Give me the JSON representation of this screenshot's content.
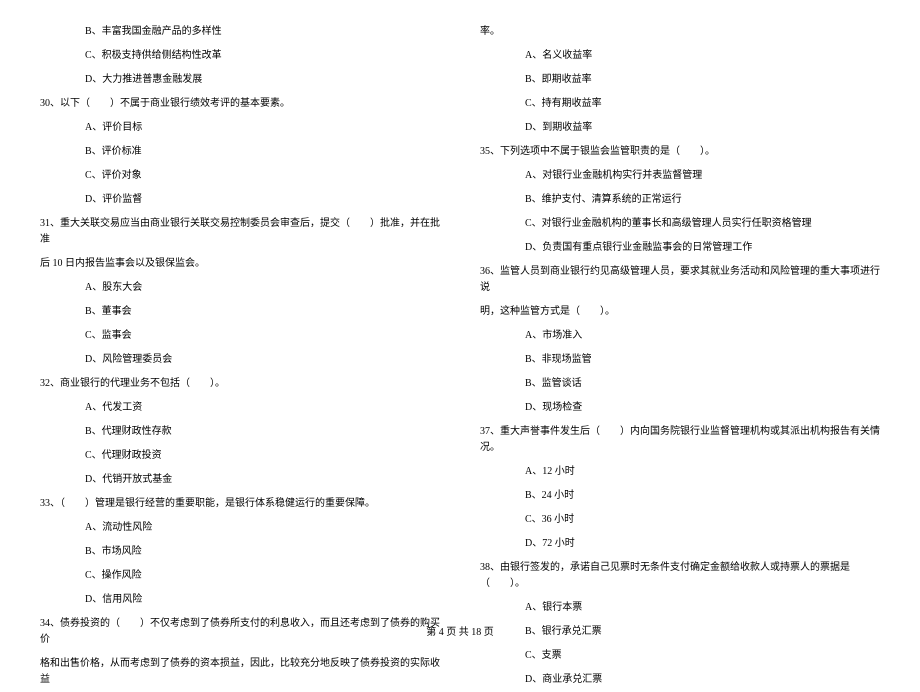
{
  "left_column": {
    "q29_options": [
      "B、丰富我国金融产品的多样性",
      "C、积极支持供给侧结构性改革",
      "D、大力推进普惠金融发展"
    ],
    "q30": {
      "text": "30、以下（　　）不属于商业银行绩效考评的基本要素。",
      "options": [
        "A、评价目标",
        "B、评价标准",
        "C、评价对象",
        "D、评价监督"
      ]
    },
    "q31": {
      "text": "31、重大关联交易应当由商业银行关联交易控制委员会审查后，提交（　　）批准，并在批准",
      "text_cont": "后 10 日内报告监事会以及银保监会。",
      "options": [
        "A、股东大会",
        "B、董事会",
        "C、监事会",
        "D、风险管理委员会"
      ]
    },
    "q32": {
      "text": "32、商业银行的代理业务不包括（　　）。",
      "options": [
        "A、代发工资",
        "B、代理财政性存款",
        "C、代理财政投资",
        "D、代销开放式基金"
      ]
    },
    "q33": {
      "text": "33、（　　）管理是银行经营的重要职能，是银行体系稳健运行的重要保障。",
      "options": [
        "A、流动性风险",
        "B、市场风险",
        "C、操作风险",
        "D、信用风险"
      ]
    },
    "q34": {
      "text": "34、债券投资的（　　）不仅考虑到了债券所支付的利息收入，而且还考虑到了债券的购买价",
      "text_cont": "格和出售价格，从而考虑到了债券的资本损益，因此，比较充分地反映了债券投资的实际收益"
    }
  },
  "right_column": {
    "q34_cont": "率。",
    "q34_options": [
      "A、名义收益率",
      "B、即期收益率",
      "C、持有期收益率",
      "D、到期收益率"
    ],
    "q35": {
      "text": "35、下列选项中不属于银监会监管职责的是（　　）。",
      "options": [
        "A、对银行业金融机构实行并表监督管理",
        "B、维护支付、清算系统的正常运行",
        "C、对银行业金融机构的董事长和高级管理人员实行任职资格管理",
        "D、负责国有重点银行业金融监事会的日常管理工作"
      ]
    },
    "q36": {
      "text": "36、监管人员到商业银行约见高级管理人员，要求其就业务活动和风险管理的重大事项进行说",
      "text_cont": "明，这种监管方式是（　　）。",
      "options": [
        "A、市场准入",
        "B、非现场监管",
        "B、监管谈话",
        "D、现场检查"
      ]
    },
    "q37": {
      "text": "37、重大声誉事件发生后（　　）内向国务院银行业监督管理机构或其派出机构报告有关情况。",
      "options": [
        "A、12 小时",
        "B、24 小时",
        "C、36 小时",
        "D、72 小时"
      ]
    },
    "q38": {
      "text": "38、由银行签发的，承诺自己见票时无条件支付确定金额给收款人或持票人的票据是（　　）。",
      "options": [
        "A、银行本票",
        "B、银行承兑汇票",
        "C、支票",
        "D、商业承兑汇票"
      ]
    }
  },
  "footer": "第 4 页 共 18 页"
}
